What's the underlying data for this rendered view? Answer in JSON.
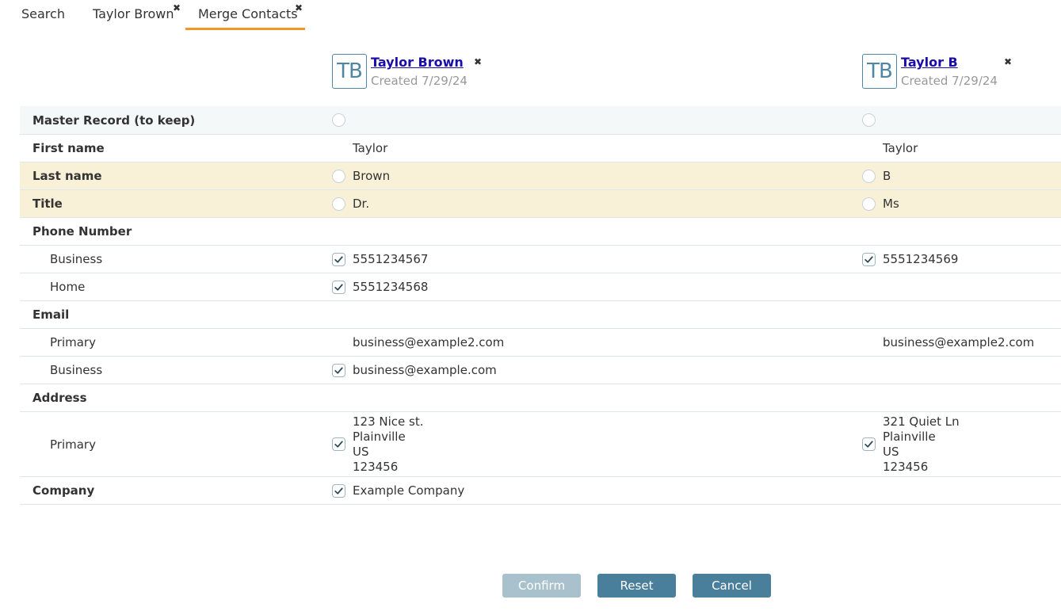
{
  "tabs": [
    {
      "label": "Search",
      "closable": false,
      "active": false
    },
    {
      "label": "Taylor Brown",
      "closable": true,
      "active": false
    },
    {
      "label": "Merge Contacts",
      "closable": true,
      "active": true
    }
  ],
  "close_glyph": "✖",
  "contacts": [
    {
      "initials": "TB",
      "name": "Taylor Brown",
      "created": "Created 7/29/24"
    },
    {
      "initials": "TB",
      "name": "Taylor B",
      "created": "Created 7/29/24"
    }
  ],
  "rows": {
    "master": {
      "label": "Master Record (to keep)"
    },
    "first_name": {
      "label": "First name",
      "a": "Taylor",
      "b": "Taylor"
    },
    "last_name": {
      "label": "Last name",
      "a": "Brown",
      "b": "B"
    },
    "title": {
      "label": "Title",
      "a": "Dr.",
      "b": "Ms"
    },
    "phone": {
      "label": "Phone Number",
      "business": {
        "label": "Business",
        "a": "5551234567",
        "b": "5551234569"
      },
      "home": {
        "label": "Home",
        "a": "5551234568"
      }
    },
    "email": {
      "label": "Email",
      "primary": {
        "label": "Primary",
        "a": "business@example2.com",
        "b": "business@example2.com"
      },
      "business": {
        "label": "Business",
        "a": "business@example.com"
      }
    },
    "address": {
      "label": "Address",
      "primary": {
        "label": "Primary",
        "a": {
          "street": "123 Nice st.",
          "city": "Plainville",
          "country": "US",
          "postal": "123456"
        },
        "b": {
          "street": "321 Quiet Ln",
          "city": "Plainville",
          "country": "US",
          "postal": "123456"
        }
      }
    },
    "company": {
      "label": "Company",
      "a": "Example Company"
    }
  },
  "buttons": {
    "confirm": "Confirm",
    "reset": "Reset",
    "cancel": "Cancel"
  },
  "colors": {
    "accent_tab": "#f0952a",
    "button": "#4a7f9b",
    "button_disabled": "#a9c1cd",
    "conflict_row": "#f8f0d7",
    "link": "#1a0dab"
  }
}
